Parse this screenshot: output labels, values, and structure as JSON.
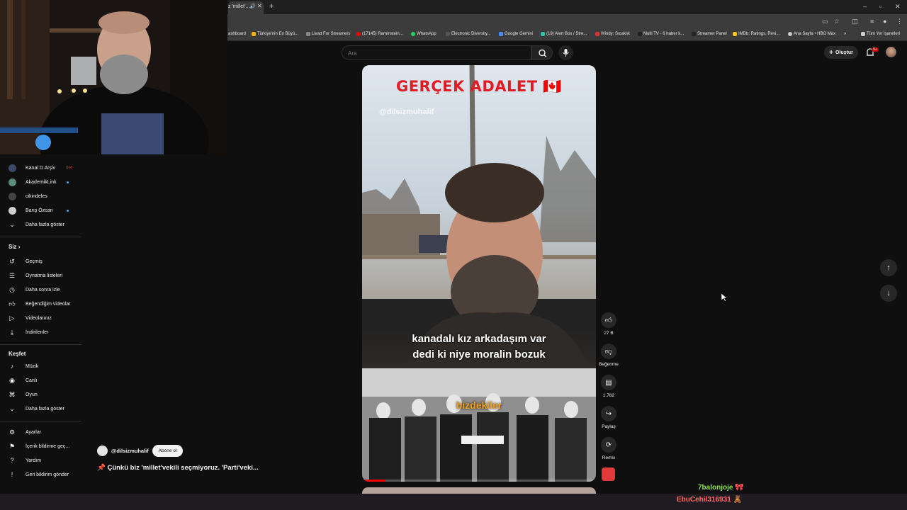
{
  "browser": {
    "tab_title": "z 'millet'...",
    "bookmarks": [
      "ashboard",
      "Türkiye'nin En Büyü...",
      "Livad For Streamers",
      "(17145) Rammstein...",
      "WhatsApp",
      "Electronic Diversity...",
      "Google Gemini",
      "(19) Alert Box / Stre...",
      "Windy: Sıcaklık",
      "Multi TV - 6 haber k...",
      "Streamer Panel",
      "IMDb: Ratings, Revi...",
      "Ana Sayfa • HBO Max"
    ],
    "bookmarks_more": "»",
    "all_bookmarks": "Tüm Yer İşaretleri"
  },
  "header": {
    "search_placeholder": "Ara",
    "create_label": "Oluştur",
    "notif_count": "9+"
  },
  "sidebar": {
    "channels": [
      {
        "label": "Kanal D Arşiv",
        "color": "#3a4a6a",
        "badge": "((•))"
      },
      {
        "label": "AkademikLink",
        "color": "#5a8a7a",
        "badge": "•"
      },
      {
        "label": "cikindeles",
        "color": "#444444",
        "badge": ""
      },
      {
        "label": "Barış Özcan",
        "color": "#cfcfcf",
        "badge": "•"
      }
    ],
    "show_more": "Daha fazla göster",
    "you_section": "Siz",
    "you_items": [
      {
        "label": "Geçmiş",
        "icon": "history-icon"
      },
      {
        "label": "Oynatma listeleri",
        "icon": "playlist-icon"
      },
      {
        "label": "Daha sonra izle",
        "icon": "clock-icon"
      },
      {
        "label": "Beğendiğim videolar",
        "icon": "thumbs-up-icon"
      },
      {
        "label": "Videolarınız",
        "icon": "video-icon"
      },
      {
        "label": "İndirilenler",
        "icon": "download-icon"
      }
    ],
    "explore_section": "Keşfet",
    "explore_items": [
      {
        "label": "Müzik",
        "icon": "music-icon"
      },
      {
        "label": "Canlı",
        "icon": "live-icon"
      },
      {
        "label": "Oyun",
        "icon": "gaming-icon"
      }
    ],
    "show_more_2": "Daha fazla göster",
    "bottom_items": [
      {
        "label": "Ayarlar",
        "icon": "settings-icon"
      },
      {
        "label": "İçerik bildirme geç...",
        "icon": "flag-icon"
      },
      {
        "label": "Yardım",
        "icon": "help-icon"
      },
      {
        "label": "Geri bildirim gönder",
        "icon": "feedback-icon"
      }
    ]
  },
  "video": {
    "title_overlay": "GERÇEK ADALET 🇨🇦",
    "watermark": "@dilsizmuhalif",
    "subtitle_line1": "kanadalı kız arkadaşım var",
    "subtitle_line2": "dedi ki niye moralin bozuk",
    "lower_label": "bizdekiler",
    "progress": 0.1
  },
  "actions": {
    "like_count": "27 B",
    "dislike_label": "Beğenme",
    "comment_count": "1.782",
    "share_label": "Paylaş",
    "remix_label": "Remix"
  },
  "channel": {
    "name": "@dilsizmuhalif",
    "subscribe_label": "Abone ol",
    "caption": "📌 Çünkü biz 'millet'vekili seçmiyoruz. 'Parti'veki..."
  },
  "chat": {
    "user1": "7balonjoje 🎀",
    "user2": "EbuCehil316931 🧸"
  }
}
